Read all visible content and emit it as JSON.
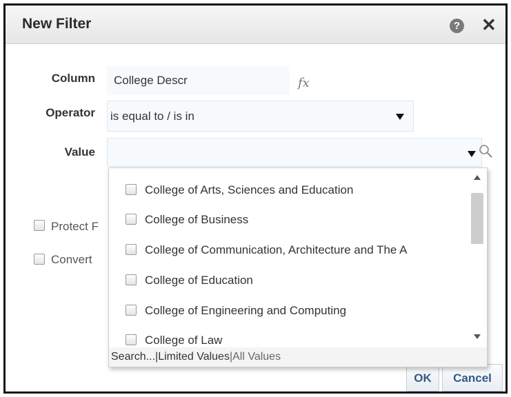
{
  "dialog": {
    "title": "New Filter",
    "help_icon": "help-icon",
    "help_glyph": "?",
    "close_icon": "close-icon",
    "close_glyph": "✕"
  },
  "form": {
    "column_label": "Column",
    "column_value": "College Descr",
    "fx_label": "fx",
    "operator_label": "Operator",
    "operator_value": "is equal to / is in",
    "value_label": "Value",
    "value_value": ""
  },
  "options": {
    "protect_label_partial": "Protect F",
    "convert_label_partial": "Convert"
  },
  "dropdown": {
    "items": [
      {
        "label": "College of Arts, Sciences and Education",
        "checked": false
      },
      {
        "label": "College of Business",
        "checked": false
      },
      {
        "label": "College of Communication, Architecture and The A",
        "checked": false
      },
      {
        "label": "College of Education",
        "checked": false
      },
      {
        "label": "College of Engineering and Computing",
        "checked": false
      },
      {
        "label": "College of Law",
        "checked": false
      }
    ],
    "footer": {
      "search": "Search...",
      "sep1": "|",
      "limited": "Limited Values",
      "sep2": "|",
      "all": "All Values"
    }
  },
  "buttons": {
    "ok": "OK",
    "cancel": "Cancel"
  }
}
